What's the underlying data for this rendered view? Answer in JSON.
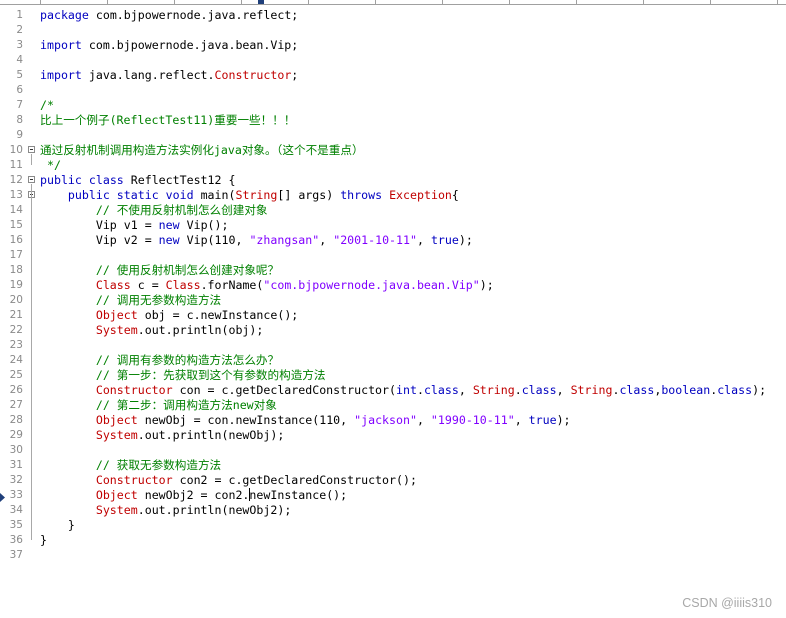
{
  "watermark": "CSDN @iiiis310",
  "colors": {
    "keyword": "#0000c0",
    "class": "#c00000",
    "string": "#8000ff",
    "comment": "#008000",
    "plain": "#000000",
    "line_number": "#8a8a8a"
  },
  "caret_line": 33,
  "fold_lines": [
    10,
    12,
    13
  ],
  "lines": [
    {
      "n": "1",
      "t": [
        [
          "kw",
          "package"
        ],
        [
          "tok",
          " com.bjpowernode.java.reflect;"
        ]
      ]
    },
    {
      "n": "2",
      "t": []
    },
    {
      "n": "3",
      "t": [
        [
          "kw",
          "import"
        ],
        [
          "tok",
          " com.bjpowernode.java.bean.Vip;"
        ]
      ]
    },
    {
      "n": "4",
      "t": []
    },
    {
      "n": "5",
      "t": [
        [
          "kw",
          "import"
        ],
        [
          "tok",
          " java.lang.reflect."
        ],
        [
          "cls",
          "Constructor"
        ],
        [
          "tok",
          ";"
        ]
      ]
    },
    {
      "n": "6",
      "t": []
    },
    {
      "n": "7",
      "t": [
        [
          "cm",
          "/*"
        ]
      ]
    },
    {
      "n": "8",
      "t": [
        [
          "cm",
          "比上一个例子(ReflectTest11)重要一些！！！"
        ]
      ]
    },
    {
      "n": "9",
      "t": []
    },
    {
      "n": "10",
      "t": [
        [
          "cm",
          "通过反射机制调用构造方法实例化java对象。（这个不是重点）"
        ]
      ]
    },
    {
      "n": "11",
      "t": [
        [
          "cm",
          " */"
        ]
      ]
    },
    {
      "n": "12",
      "t": [
        [
          "kw",
          "public"
        ],
        [
          "tok",
          " "
        ],
        [
          "kw",
          "class"
        ],
        [
          "tok",
          " ReflectTest12 {"
        ]
      ]
    },
    {
      "n": "13",
      "t": [
        [
          "tok",
          "    "
        ],
        [
          "kw",
          "public"
        ],
        [
          "tok",
          " "
        ],
        [
          "kw",
          "static"
        ],
        [
          "tok",
          " "
        ],
        [
          "kw",
          "void"
        ],
        [
          "tok",
          " main("
        ],
        [
          "cls",
          "String"
        ],
        [
          "tok",
          "[] args) "
        ],
        [
          "kw",
          "throws"
        ],
        [
          "tok",
          " "
        ],
        [
          "cls",
          "Exception"
        ],
        [
          "tok",
          "{"
        ]
      ]
    },
    {
      "n": "14",
      "t": [
        [
          "tok",
          "        "
        ],
        [
          "cm",
          "// 不使用反射机制怎么创建对象"
        ]
      ]
    },
    {
      "n": "15",
      "t": [
        [
          "tok",
          "        Vip v1 = "
        ],
        [
          "kw",
          "new"
        ],
        [
          "tok",
          " Vip();"
        ]
      ]
    },
    {
      "n": "16",
      "t": [
        [
          "tok",
          "        Vip v2 = "
        ],
        [
          "kw",
          "new"
        ],
        [
          "tok",
          " Vip(110, "
        ],
        [
          "str",
          "\"zhangsan\""
        ],
        [
          "tok",
          ", "
        ],
        [
          "str",
          "\"2001-10-11\""
        ],
        [
          "tok",
          ", "
        ],
        [
          "kw",
          "true"
        ],
        [
          "tok",
          ");"
        ]
      ]
    },
    {
      "n": "17",
      "t": []
    },
    {
      "n": "18",
      "t": [
        [
          "tok",
          "        "
        ],
        [
          "cm",
          "// 使用反射机制怎么创建对象呢？"
        ]
      ]
    },
    {
      "n": "19",
      "t": [
        [
          "tok",
          "        "
        ],
        [
          "cls",
          "Class"
        ],
        [
          "tok",
          " c = "
        ],
        [
          "cls",
          "Class"
        ],
        [
          "tok",
          ".forName("
        ],
        [
          "str",
          "\"com.bjpowernode.java.bean.Vip\""
        ],
        [
          "tok",
          ");"
        ]
      ]
    },
    {
      "n": "20",
      "t": [
        [
          "tok",
          "        "
        ],
        [
          "cm",
          "// 调用无参数构造方法"
        ]
      ]
    },
    {
      "n": "21",
      "t": [
        [
          "tok",
          "        "
        ],
        [
          "cls",
          "Object"
        ],
        [
          "tok",
          " obj = c.newInstance();"
        ]
      ]
    },
    {
      "n": "22",
      "t": [
        [
          "tok",
          "        "
        ],
        [
          "cls",
          "System"
        ],
        [
          "tok",
          ".out.println(obj);"
        ]
      ]
    },
    {
      "n": "23",
      "t": []
    },
    {
      "n": "24",
      "t": [
        [
          "tok",
          "        "
        ],
        [
          "cm",
          "// 调用有参数的构造方法怎么办？"
        ]
      ]
    },
    {
      "n": "25",
      "t": [
        [
          "tok",
          "        "
        ],
        [
          "cm",
          "// 第一步：先获取到这个有参数的构造方法"
        ]
      ]
    },
    {
      "n": "26",
      "t": [
        [
          "tok",
          "        "
        ],
        [
          "cls",
          "Constructor"
        ],
        [
          "tok",
          " con = c.getDeclaredConstructor("
        ],
        [
          "kw",
          "int"
        ],
        [
          "tok",
          "."
        ],
        [
          "kw",
          "class"
        ],
        [
          "tok",
          ", "
        ],
        [
          "cls",
          "String"
        ],
        [
          "tok",
          "."
        ],
        [
          "kw",
          "class"
        ],
        [
          "tok",
          ", "
        ],
        [
          "cls",
          "String"
        ],
        [
          "tok",
          "."
        ],
        [
          "kw",
          "class"
        ],
        [
          "tok",
          ","
        ],
        [
          "kw",
          "boolean"
        ],
        [
          "tok",
          "."
        ],
        [
          "kw",
          "class"
        ],
        [
          "tok",
          ");"
        ]
      ]
    },
    {
      "n": "27",
      "t": [
        [
          "tok",
          "        "
        ],
        [
          "cm",
          "// 第二步：调用构造方法new对象"
        ]
      ]
    },
    {
      "n": "28",
      "t": [
        [
          "tok",
          "        "
        ],
        [
          "cls",
          "Object"
        ],
        [
          "tok",
          " newObj = con.newInstance(110, "
        ],
        [
          "str",
          "\"jackson\""
        ],
        [
          "tok",
          ", "
        ],
        [
          "str",
          "\"1990-10-11\""
        ],
        [
          "tok",
          ", "
        ],
        [
          "kw",
          "true"
        ],
        [
          "tok",
          ");"
        ]
      ]
    },
    {
      "n": "29",
      "t": [
        [
          "tok",
          "        "
        ],
        [
          "cls",
          "System"
        ],
        [
          "tok",
          ".out.println(newObj);"
        ]
      ]
    },
    {
      "n": "30",
      "t": []
    },
    {
      "n": "31",
      "t": [
        [
          "tok",
          "        "
        ],
        [
          "cm",
          "// 获取无参数构造方法"
        ]
      ]
    },
    {
      "n": "32",
      "t": [
        [
          "tok",
          "        "
        ],
        [
          "cls",
          "Constructor"
        ],
        [
          "tok",
          " con2 = c.getDeclaredConstructor();"
        ]
      ]
    },
    {
      "n": "33",
      "t": [
        [
          "tok",
          "        "
        ],
        [
          "cls",
          "Object"
        ],
        [
          "tok",
          " newObj2 = con2."
        ],
        [
          "caret",
          ""
        ],
        [
          "tok",
          "newInstance();"
        ]
      ]
    },
    {
      "n": "34",
      "t": [
        [
          "tok",
          "        "
        ],
        [
          "cls",
          "System"
        ],
        [
          "tok",
          ".out.println(newObj2);"
        ]
      ]
    },
    {
      "n": "35",
      "t": [
        [
          "tok",
          "    }"
        ]
      ]
    },
    {
      "n": "36",
      "t": [
        [
          "tok",
          "}"
        ]
      ]
    },
    {
      "n": "37",
      "t": []
    }
  ]
}
